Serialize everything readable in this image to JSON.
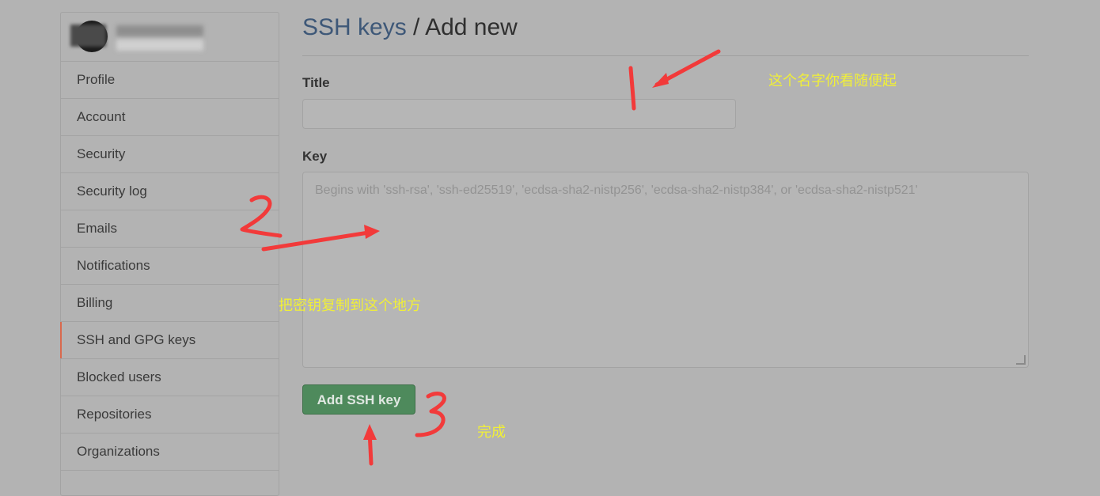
{
  "header": {
    "title_link": "SSH keys",
    "title_sep": " / ",
    "title_current": "Add new"
  },
  "sidebar": {
    "items": [
      {
        "label": "Profile"
      },
      {
        "label": "Account"
      },
      {
        "label": "Security"
      },
      {
        "label": "Security log"
      },
      {
        "label": "Emails"
      },
      {
        "label": "Notifications"
      },
      {
        "label": "Billing"
      },
      {
        "label": "SSH and GPG keys",
        "selected": true
      },
      {
        "label": "Blocked users"
      },
      {
        "label": "Repositories"
      },
      {
        "label": "Organizations"
      }
    ],
    "accent_color": "#d9694d"
  },
  "form": {
    "title_label": "Title",
    "title_value": "",
    "key_label": "Key",
    "key_placeholder": "Begins with 'ssh-rsa', 'ssh-ed25519', 'ecdsa-sha2-nistp256', 'ecdsa-sha2-nistp384', or 'ecdsa-sha2-nistp521'",
    "submit_label": "Add SSH key",
    "submit_color": "#4e8a5c"
  },
  "annotations": {
    "note_title": "这个名字你看随便起",
    "note_key": "把密钥复制到这个地方",
    "note_done": "完成",
    "color_text": "#f0ef38",
    "color_marks": "#f23a3a"
  }
}
